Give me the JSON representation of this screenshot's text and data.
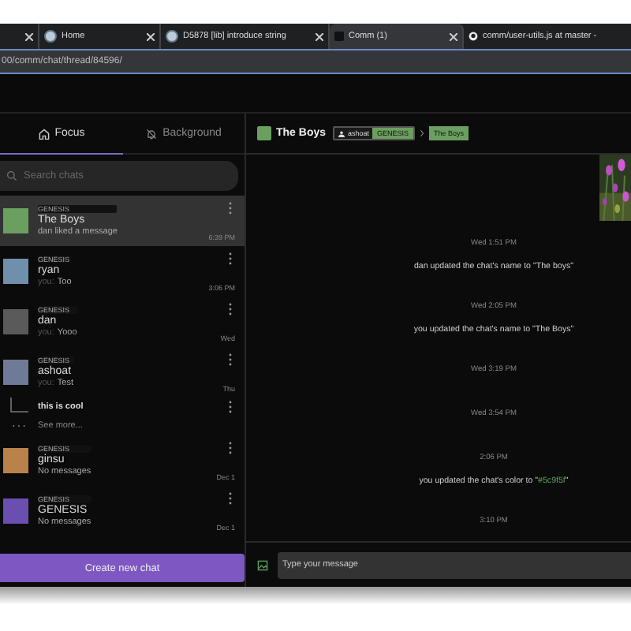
{
  "browser": {
    "tabs": [
      {
        "selected": false,
        "kind": "blank"
      },
      {
        "title": "Home",
        "selected": false,
        "kind": "gear"
      },
      {
        "title": "D5878 [lib] introduce string",
        "selected": false,
        "kind": "gear"
      },
      {
        "title": "Comm (1)",
        "selected": true,
        "kind": "comm"
      },
      {
        "title": "comm/user-utils.js at master -",
        "selected": false,
        "kind": "github"
      }
    ],
    "url": "00/comm/chat/thread/84596/"
  },
  "sidebar": {
    "tabs": [
      {
        "label": "Focus",
        "selected": true,
        "kind": "home"
      },
      {
        "label": "Background",
        "selected": false,
        "kind": "bell"
      }
    ],
    "search": {
      "placeholder": "Search chats"
    },
    "chats": [
      {
        "kind": "chat",
        "community": "GENESIS",
        "name": "The Boys",
        "preview": "dan liked a message",
        "time": "6:39 PM",
        "color": "#6b9f5f",
        "selected": true
      },
      {
        "kind": "chat",
        "community": "GENESIS",
        "name": "ryan",
        "author": "you:",
        "preview": "Too",
        "time": "3:06 PM",
        "color": "#6f8fad",
        "selected": false
      },
      {
        "kind": "chat",
        "community": "GENESIS",
        "name": "dan",
        "author": "you:",
        "preview": "Yooo",
        "time": "Wed",
        "color": "#5a5a5a",
        "selected": false
      },
      {
        "kind": "chat",
        "community": "GENESIS",
        "name": "ashoat",
        "author": "you:",
        "preview": "Test",
        "time": "Thu",
        "color": "#6e7a96",
        "selected": false
      },
      {
        "kind": "thread",
        "name": "this is cool"
      },
      {
        "kind": "more",
        "label": "See more..."
      },
      {
        "kind": "chat",
        "community": "GENESIS",
        "name": "ginsu",
        "preview": "No messages",
        "time": "Dec 1",
        "color": "#b8824a",
        "selected": false
      },
      {
        "kind": "chat",
        "community": "GENESIS",
        "name": "GENESIS",
        "preview": "No messages",
        "time": "Dec 1",
        "color": "#6a4fb0",
        "selected": false
      }
    ],
    "create_button": "Create new chat"
  },
  "thread": {
    "name": "The Boys",
    "color": "#6b9f5f",
    "owner": "ashoat",
    "community": "GENESIS",
    "breadcrumb": "The Boys",
    "messages": [
      {
        "kind": "picture"
      },
      {
        "kind": "time",
        "text": "Wed 1:51 PM"
      },
      {
        "kind": "notice",
        "text": "dan updated the chat's name to \"The boys\""
      },
      {
        "kind": "time",
        "text": "Wed 2:05 PM"
      },
      {
        "kind": "notice",
        "text": "you updated the chat's name to \"The Boys\""
      },
      {
        "kind": "time",
        "text": "Wed 3:19 PM"
      },
      {
        "kind": "time",
        "text": "Wed 3:54 PM"
      },
      {
        "kind": "time",
        "text": "2:06 PM"
      },
      {
        "kind": "color_notice",
        "before": "you updated the chat's color to \"",
        "code": "#5c9f5f",
        "after": "\""
      },
      {
        "kind": "time",
        "text": "3:10 PM"
      }
    ],
    "composer": {
      "placeholder": "Type your message"
    }
  }
}
